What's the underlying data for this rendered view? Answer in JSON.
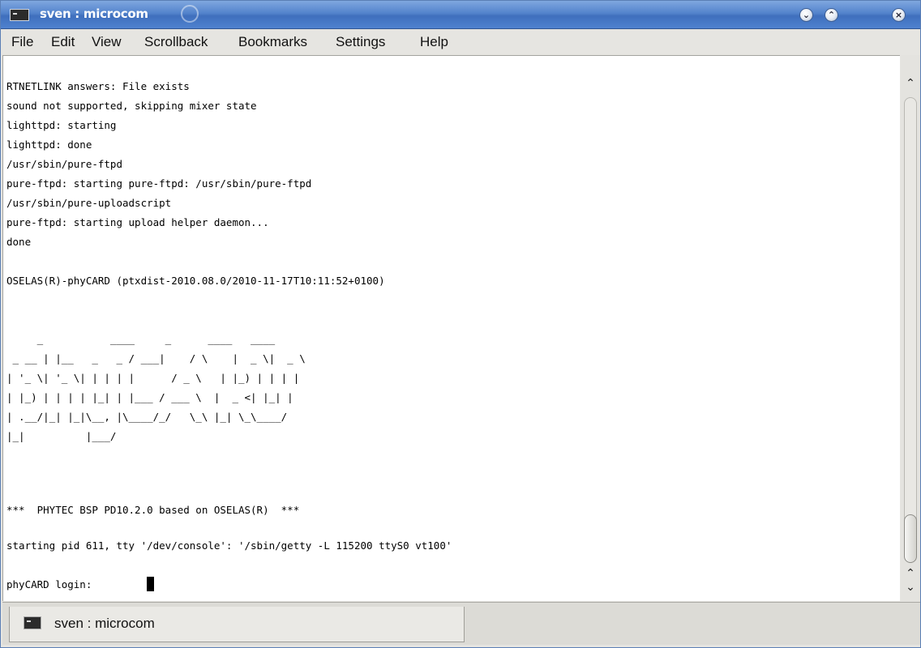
{
  "window": {
    "title": "sven : microcom"
  },
  "menu": {
    "items": [
      "File",
      "Edit",
      "View",
      "Scrollback",
      "Bookmarks",
      "Settings",
      "Help"
    ]
  },
  "terminal": {
    "lines": [
      "RTNETLINK answers: File exists",
      "sound not supported, skipping mixer state",
      "lighttpd: starting",
      "lighttpd: done",
      "/usr/sbin/pure-ftpd",
      "pure-ftpd: starting pure-ftpd: /usr/sbin/pure-ftpd",
      "/usr/sbin/pure-uploadscript",
      "pure-ftpd: starting upload helper daemon...",
      "done",
      "",
      "OSELAS(R)-phyCARD (ptxdist-2010.08.0/2010-11-17T10:11:52+0100)",
      "",
      "",
      "     _           ____     _      ____   ____",
      " _ __ | |__   _   _ / ___|    / \\    |  _ \\|  _ \\",
      "| '_ \\| '_ \\| | | | |      / _ \\   | |_) | | | |",
      "| |_) | | | | |_| | |___ / ___ \\  |  _ <| |_| |",
      "| .__/|_| |_|\\__, |\\____/_/   \\_\\ |_| \\_\\____/",
      "|_|          |___/",
      "",
      "",
      "",
      "***  PHYTEC BSP PD10.2.0 based on OSELAS(R)  ***",
      "",
      "starting pid 611, tty '/dev/console': '/sbin/getty -L 115200 ttyS0 vt100'",
      "",
      "phyCARD login: "
    ]
  },
  "tabs": [
    {
      "label": "sven : microcom"
    }
  ],
  "icons": {
    "app": "terminal-icon",
    "minimize": "chevron-down-icon",
    "maximize": "chevron-up-icon",
    "close": "close-icon",
    "decoration": "swirl-icon"
  }
}
